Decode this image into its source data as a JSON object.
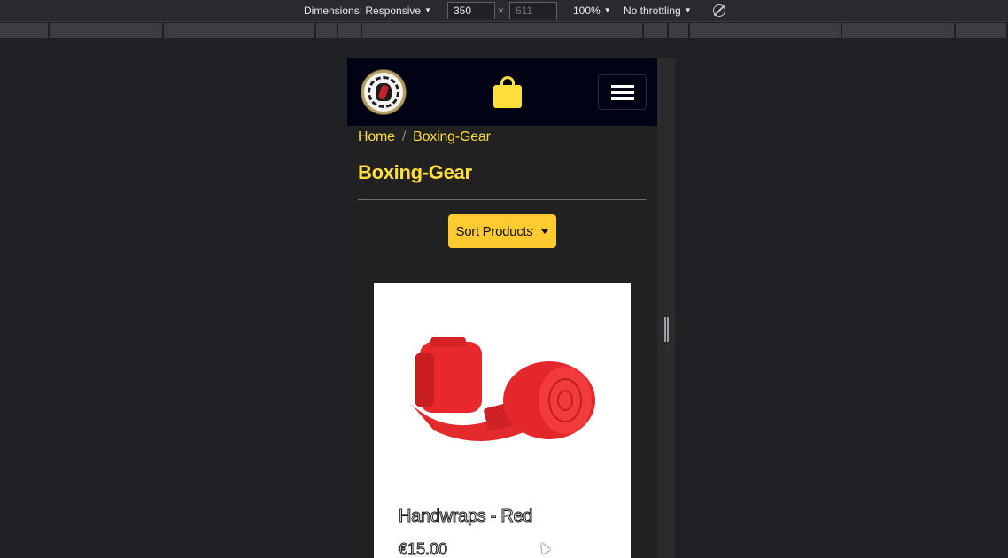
{
  "devtools": {
    "dimensions_label": "Dimensions: Responsive",
    "width_value": "350",
    "height_placeholder": "611",
    "times_sign": "×",
    "zoom": "100%",
    "throttling": "No throttling"
  },
  "site": {
    "breadcrumb": {
      "home": "Home",
      "separator": "/",
      "current": "Boxing-Gear"
    },
    "page_title": "Boxing-Gear",
    "sort_button": "Sort Products",
    "products": [
      {
        "name": "Handwraps - Red",
        "price": "€15.00",
        "image": "red-handwraps"
      }
    ],
    "colors": {
      "navbar": "#010314",
      "accent": "#fede3a",
      "sort_button": "#fdcb2f",
      "page_bg": "#212121"
    }
  }
}
